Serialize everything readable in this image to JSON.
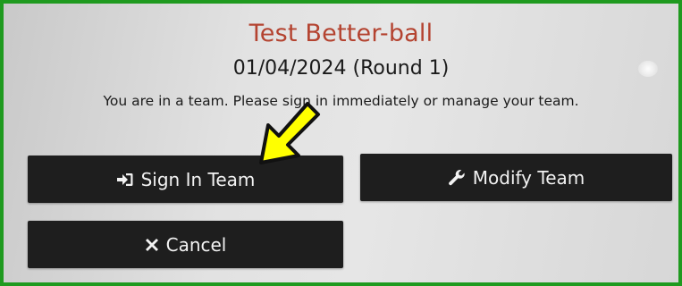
{
  "dialog": {
    "title": "Test Better-ball",
    "date_round": "01/04/2024 (Round 1)",
    "message": "You are in a team. Please sign in immediately or manage your team."
  },
  "buttons": {
    "sign_in_label": "Sign In Team",
    "modify_label": "Modify Team",
    "cancel_label": "Cancel"
  },
  "icons": {
    "sign_in": "sign-in-icon",
    "modify": "wrench-icon",
    "cancel": "times-icon"
  },
  "colors": {
    "frame_border": "#1f9a1f",
    "title": "#b44330",
    "button_bg": "#1e1e1e",
    "button_text": "#f2f2f2",
    "arrow_fill": "#ffff00"
  }
}
